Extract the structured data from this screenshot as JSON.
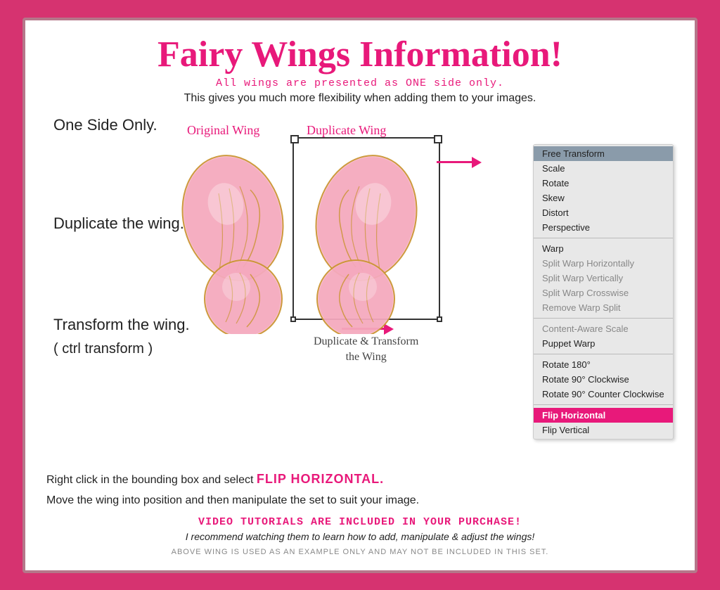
{
  "page": {
    "title": "Fairy Wings Information!",
    "subtitle_pink": "All wings are presented as ONE side only.",
    "subtitle_black": "This gives you much more flexibility when adding them to your images.",
    "label_one_side": "One Side Only.",
    "label_duplicate": "Duplicate the wing.",
    "label_transform_1": "Transform the wing.",
    "label_transform_2": "( ctrl transform )",
    "original_wing_label": "Original Wing",
    "duplicate_wing_label": "Duplicate Wing",
    "dup_transform_label_1": "Duplicate & Transform",
    "dup_transform_label_2": "the Wing",
    "flip_instruction": "Right click in the bounding box and select",
    "flip_highlight": "FLIP HORIZONTAL.",
    "move_instruction": "Move the wing into position and then manipulate the set to suit your image.",
    "video_text": "VIDEO TUTORIALS ARE INCLUDED IN YOUR PURCHASE!",
    "recommend_text": "I recommend watching them to learn how to add, manipulate & adjust the wings!",
    "disclaimer": "ABOVE WING IS USED AS AN EXAMPLE ONLY AND MAY NOT BE INCLUDED IN THIS SET.",
    "menu": {
      "items": [
        {
          "label": "Free Transform",
          "highlighted": true,
          "dimmed": false,
          "flip": false
        },
        {
          "label": "Scale",
          "highlighted": false,
          "dimmed": false,
          "flip": false
        },
        {
          "label": "Rotate",
          "highlighted": false,
          "dimmed": false,
          "flip": false
        },
        {
          "label": "Skew",
          "highlighted": false,
          "dimmed": false,
          "flip": false
        },
        {
          "label": "Distort",
          "highlighted": false,
          "dimmed": false,
          "flip": false
        },
        {
          "label": "Perspective",
          "highlighted": false,
          "dimmed": false,
          "flip": false
        },
        {
          "label": "sep1",
          "highlighted": false,
          "dimmed": false,
          "flip": false
        },
        {
          "label": "Warp",
          "highlighted": false,
          "dimmed": false,
          "flip": false
        },
        {
          "label": "Split Warp Horizontally",
          "highlighted": false,
          "dimmed": true,
          "flip": false
        },
        {
          "label": "Split Warp Vertically",
          "highlighted": false,
          "dimmed": true,
          "flip": false
        },
        {
          "label": "Split Warp Crosswise",
          "highlighted": false,
          "dimmed": true,
          "flip": false
        },
        {
          "label": "Remove Warp Split",
          "highlighted": false,
          "dimmed": true,
          "flip": false
        },
        {
          "label": "sep2",
          "highlighted": false,
          "dimmed": false,
          "flip": false
        },
        {
          "label": "Content-Aware Scale",
          "highlighted": false,
          "dimmed": true,
          "flip": false
        },
        {
          "label": "Puppet Warp",
          "highlighted": false,
          "dimmed": false,
          "flip": false
        },
        {
          "label": "sep3",
          "highlighted": false,
          "dimmed": false,
          "flip": false
        },
        {
          "label": "Rotate 180°",
          "highlighted": false,
          "dimmed": false,
          "flip": false
        },
        {
          "label": "Rotate 90° Clockwise",
          "highlighted": false,
          "dimmed": false,
          "flip": false
        },
        {
          "label": "Rotate 90° Counter Clockwise",
          "highlighted": false,
          "dimmed": false,
          "flip": false
        },
        {
          "label": "sep4",
          "highlighted": false,
          "dimmed": false,
          "flip": false
        },
        {
          "label": "Flip Horizontal",
          "highlighted": false,
          "dimmed": false,
          "flip": true
        },
        {
          "label": "Flip Vertical",
          "highlighted": false,
          "dimmed": false,
          "flip": false
        }
      ]
    }
  }
}
